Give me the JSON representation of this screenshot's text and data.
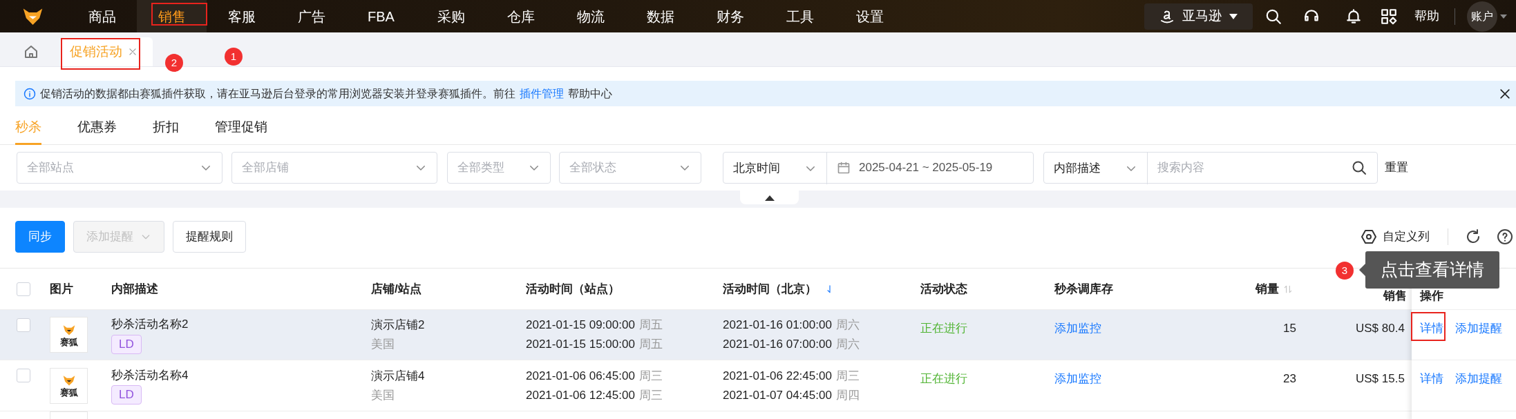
{
  "nav": {
    "items": [
      {
        "label": "商品",
        "selected": false
      },
      {
        "label": "销售",
        "selected": true,
        "annotation": "1"
      },
      {
        "label": "客服",
        "selected": false
      },
      {
        "label": "广告",
        "selected": false
      },
      {
        "label": "FBA",
        "selected": false
      },
      {
        "label": "采购",
        "selected": false
      },
      {
        "label": "仓库",
        "selected": false
      },
      {
        "label": "物流",
        "selected": false
      },
      {
        "label": "数据",
        "selected": false
      },
      {
        "label": "财务",
        "selected": false
      },
      {
        "label": "工具",
        "selected": false
      },
      {
        "label": "设置",
        "selected": false
      }
    ],
    "marketplace": "亚马逊",
    "help": "帮助",
    "account": "账户"
  },
  "page_tabs": [
    {
      "label": "促销活动",
      "selected": true,
      "annotation": "2"
    }
  ],
  "notice": {
    "text": "促销活动的数据都由赛狐插件获取，请在亚马逊后台登录的常用浏览器安装并登录赛狐插件。前往",
    "links": [
      {
        "text": "插件管理",
        "kind": "link"
      },
      {
        "text": "帮助中心",
        "kind": "plain"
      }
    ]
  },
  "sub_tabs": [
    {
      "label": "秒杀",
      "selected": true
    },
    {
      "label": "优惠券",
      "selected": false
    },
    {
      "label": "折扣",
      "selected": false
    },
    {
      "label": "管理促销",
      "selected": false
    }
  ],
  "filters": [
    {
      "kind": "select",
      "placeholder": "全部站点"
    },
    {
      "kind": "select",
      "placeholder": "全部店铺"
    },
    {
      "kind": "select",
      "placeholder": "全部类型"
    },
    {
      "kind": "select",
      "placeholder": "全部状态"
    },
    {
      "kind": "select",
      "value": "北京时间"
    },
    {
      "kind": "date-range",
      "value": "2025-04-21 ~ 2025-05-19"
    },
    {
      "kind": "select",
      "value": "内部描述"
    },
    {
      "kind": "search",
      "placeholder": "搜索内容"
    }
  ],
  "reset": "重置",
  "toolbar": {
    "buttons": [
      {
        "label": "同步",
        "kind": "primary",
        "disabled": false
      },
      {
        "label": "添加提醒",
        "kind": "dropdown",
        "disabled": true
      },
      {
        "label": "提醒规则",
        "kind": "default",
        "disabled": false
      }
    ],
    "custom_columns": "自定义列"
  },
  "table": {
    "select_all_checked": false,
    "columns": [
      {
        "label": "图片"
      },
      {
        "label": "内部描述"
      },
      {
        "label": "店铺/站点"
      },
      {
        "label": "活动时间（站点）"
      },
      {
        "label": "活动时间（北京）",
        "sorted": true
      },
      {
        "label": "活动状态"
      },
      {
        "label": "秒杀调库存"
      },
      {
        "label": "销量",
        "sorted": false
      },
      {
        "label": "销售"
      },
      {
        "label": "操作"
      }
    ],
    "rows": [
      {
        "highlighted": true,
        "checked": false,
        "image_caption": "赛狐",
        "name": "秒杀活动名称2",
        "tag": "LD",
        "store": "演示店铺2",
        "site": "美国",
        "site_times": [
          {
            "time": "2021-01-15 09:00:00",
            "weekday": "周五"
          },
          {
            "time": "2021-01-15 15:00:00",
            "weekday": "周五"
          }
        ],
        "beijing_times": [
          {
            "time": "2021-01-16 01:00:00",
            "weekday": "周六"
          },
          {
            "time": "2021-01-16 07:00:00",
            "weekday": "周六"
          }
        ],
        "status": "正在进行",
        "stock_action": "添加监控",
        "sales": "15",
        "revenue": "US$ 80.4",
        "actions": [
          {
            "label": "详情",
            "annotation": "3",
            "tooltip": "点击查看详情"
          },
          {
            "label": "添加提醒"
          }
        ]
      },
      {
        "highlighted": false,
        "checked": false,
        "image_caption": "赛狐",
        "name": "秒杀活动名称4",
        "tag": "LD",
        "store": "演示店铺4",
        "site": "美国",
        "site_times": [
          {
            "time": "2021-01-06 06:45:00",
            "weekday": "周三"
          },
          {
            "time": "2021-01-06 12:45:00",
            "weekday": "周三"
          }
        ],
        "beijing_times": [
          {
            "time": "2021-01-06 22:45:00",
            "weekday": "周三"
          },
          {
            "time": "2021-01-07 04:45:00",
            "weekday": "周四"
          }
        ],
        "status": "正在进行",
        "stock_action": "添加监控",
        "sales": "23",
        "revenue": "US$ 15.5",
        "actions": [
          {
            "label": "详情"
          },
          {
            "label": "添加提醒"
          }
        ]
      }
    ]
  }
}
